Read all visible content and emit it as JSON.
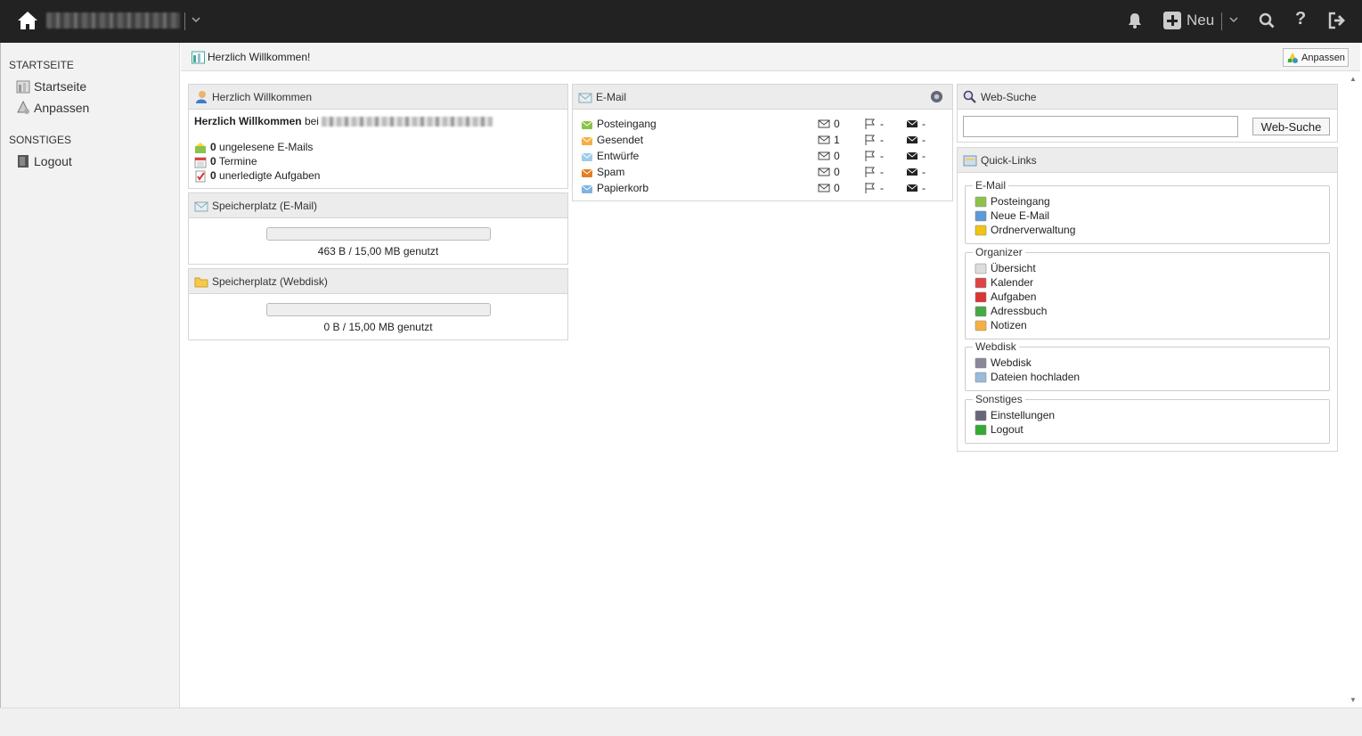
{
  "topbar": {
    "site_name": "",
    "new_label": "Neu",
    "help_label": "?",
    "icons": [
      "home-icon",
      "bell-icon",
      "plus-icon",
      "search-icon",
      "help-icon",
      "signout-icon"
    ]
  },
  "sidebar": {
    "section1": "STARTSEITE",
    "section1_items": [
      {
        "label": "Startseite",
        "icon": "dashboard-icon"
      },
      {
        "label": "Anpassen",
        "icon": "customize-icon"
      }
    ],
    "section2": "SONSTIGES",
    "section2_items": [
      {
        "label": "Logout",
        "icon": "logout-icon"
      }
    ]
  },
  "header": {
    "title": "Herzlich Willkommen!",
    "customize_label": "Anpassen"
  },
  "welcome": {
    "title": "Herzlich Willkommen",
    "greeting_bold": "Herzlich Willkommen",
    "greeting_rest": "bei",
    "stats": [
      {
        "count": "0",
        "label": "ungelesene E-Mails",
        "icon": "inbox-icon"
      },
      {
        "count": "0",
        "label": "Termine",
        "icon": "calendar-icon"
      },
      {
        "count": "0",
        "label": "unerledigte Aufgaben",
        "icon": "tasks-icon"
      }
    ]
  },
  "storage_email": {
    "title": "Speicherplatz (E-Mail)",
    "usage_text": "463 B / 15,00 MB genutzt",
    "used_fraction": 0.0
  },
  "storage_webdisk": {
    "title": "Speicherplatz (Webdisk)",
    "usage_text": "0 B / 15,00 MB genutzt",
    "used_fraction": 0.0
  },
  "email": {
    "title": "E-Mail",
    "folders": [
      {
        "name": "Posteingang",
        "count": "0",
        "flag": "-",
        "unread": "-"
      },
      {
        "name": "Gesendet",
        "count": "1",
        "flag": "-",
        "unread": "-"
      },
      {
        "name": "Entwürfe",
        "count": "0",
        "flag": "-",
        "unread": "-"
      },
      {
        "name": "Spam",
        "count": "0",
        "flag": "-",
        "unread": "-"
      },
      {
        "name": "Papierkorb",
        "count": "0",
        "flag": "-",
        "unread": "-"
      }
    ]
  },
  "websearch": {
    "title": "Web-Suche",
    "input_value": "",
    "button_label": "Web-Suche"
  },
  "quicklinks": {
    "title": "Quick-Links",
    "groups": [
      {
        "title": "E-Mail",
        "links": [
          "Posteingang",
          "Neue E-Mail",
          "Ordnerverwaltung"
        ]
      },
      {
        "title": "Organizer",
        "links": [
          "Übersicht",
          "Kalender",
          "Aufgaben",
          "Adressbuch",
          "Notizen"
        ]
      },
      {
        "title": "Webdisk",
        "links": [
          "Webdisk",
          "Dateien hochladen"
        ]
      },
      {
        "title": "Sonstiges",
        "links": [
          "Einstellungen",
          "Logout"
        ]
      }
    ]
  },
  "colors": {
    "topbar_bg": "#222222",
    "panel_header_bg": "#ececec",
    "sidebar_bg": "#f2f2f2"
  }
}
